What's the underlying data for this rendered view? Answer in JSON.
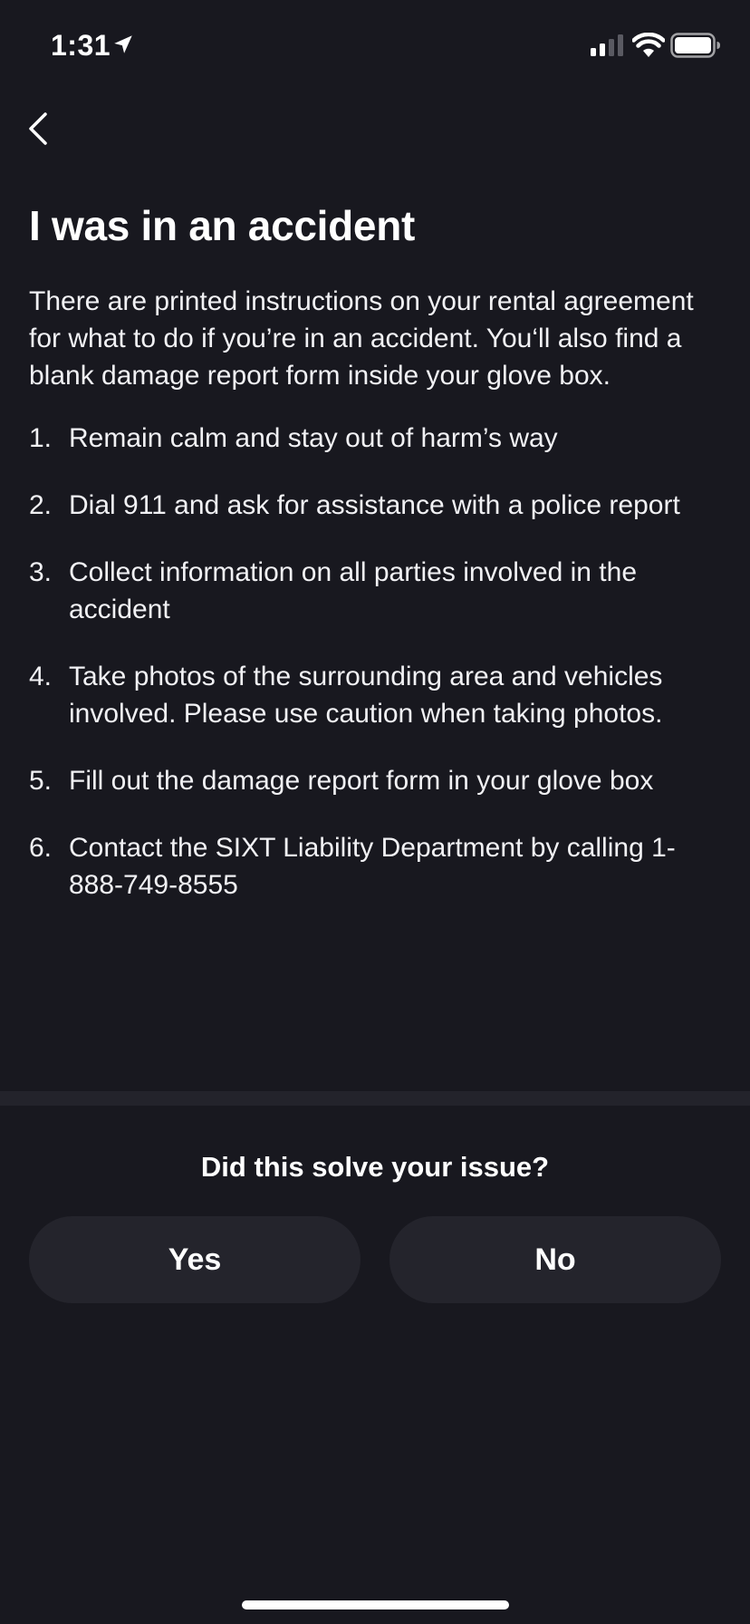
{
  "status_bar": {
    "time": "1:31",
    "icons": [
      "location-arrow-icon",
      "cellular-signal-icon",
      "wifi-icon",
      "battery-icon"
    ]
  },
  "nav": {
    "back_icon": "chevron-left-icon"
  },
  "page": {
    "title": "I was in an accident",
    "intro": "There are printed instructions on your rental agreement for what to do if you’re in an accident. You‘ll also find a blank damage report form inside your glove box.",
    "steps": [
      {
        "num": "1.",
        "text": "Remain calm and stay out of harm’s way"
      },
      {
        "num": "2.",
        "text": "Dial 911 and ask for assistance with a police report"
      },
      {
        "num": "3.",
        "text": "Collect information on all parties involved in the accident"
      },
      {
        "num": "4.",
        "text": "Take photos of the surrounding area and vehicles involved. Please use caution when taking photos."
      },
      {
        "num": "5.",
        "text": "Fill out the damage report form in your glove box"
      },
      {
        "num": "6.",
        "text": "Contact the SIXT Liability Department by calling 1-888-749-8555"
      }
    ]
  },
  "feedback": {
    "question": "Did this solve your issue?",
    "yes_label": "Yes",
    "no_label": "No"
  },
  "colors": {
    "background": "#18181f",
    "button_bg": "#24242c",
    "divider": "#23232b",
    "text": "#ffffff"
  }
}
